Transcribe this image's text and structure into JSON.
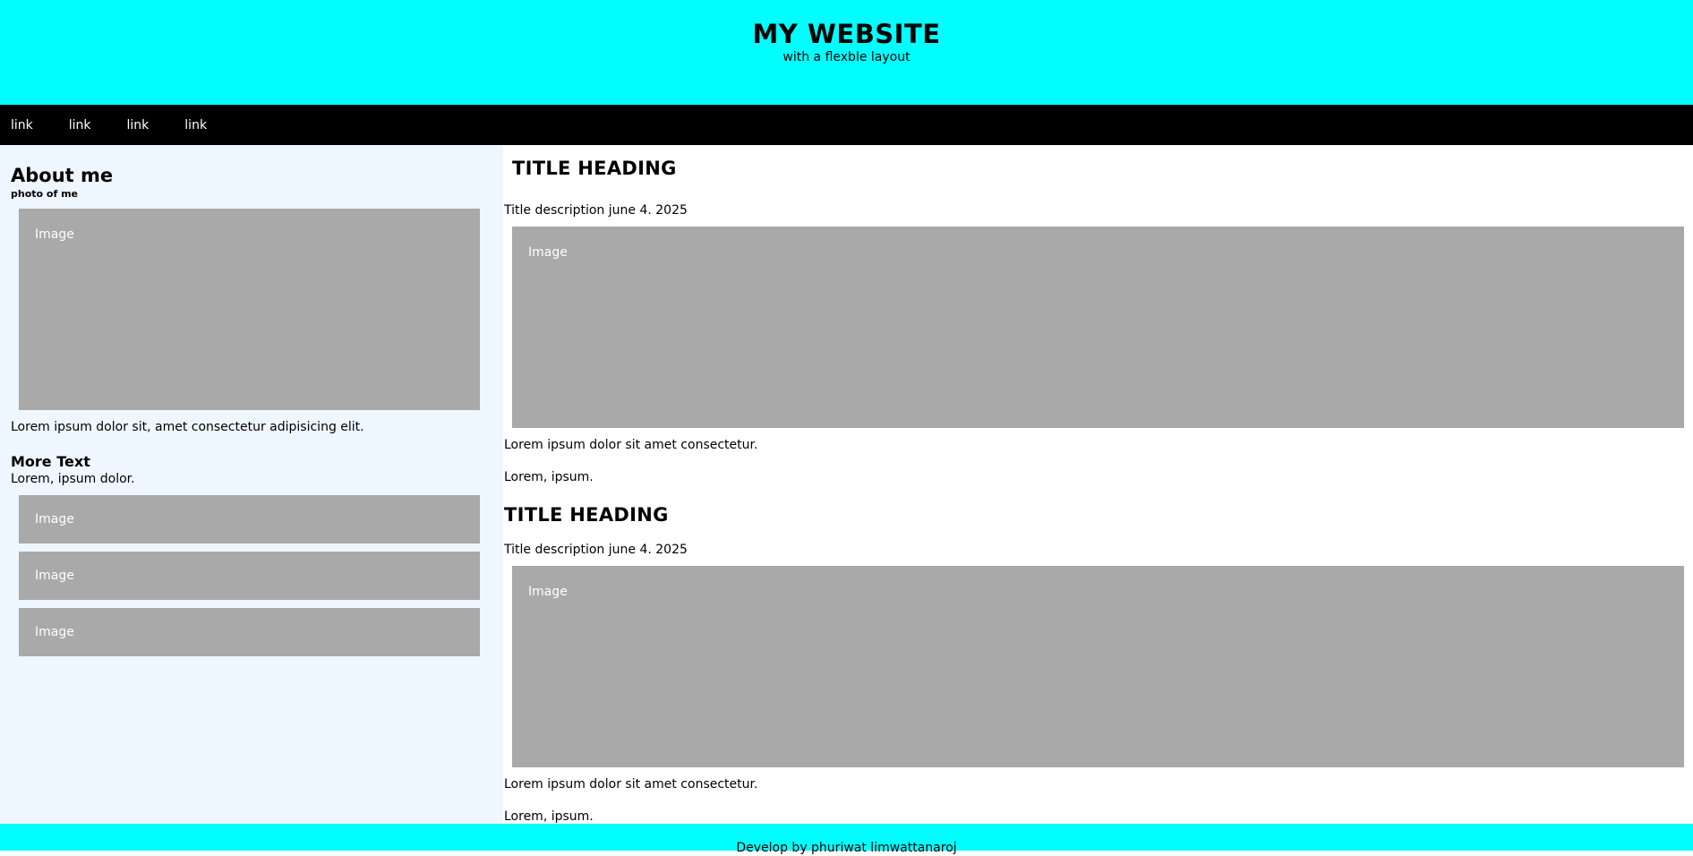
{
  "header": {
    "title": "MY WEBSITE",
    "subtitle": "with a flexble layout"
  },
  "nav": {
    "links": [
      "link",
      "link",
      "link",
      "link"
    ]
  },
  "sidebar": {
    "about_title": "About me",
    "photo_label": "photo of me",
    "main_image_label": "Image",
    "lorem": "Lorem ipsum dolor sit, amet consectetur adipisicing elit.",
    "more_title": "More Text",
    "more_text": "Lorem, ipsum dolor.",
    "thumb_images": [
      "Image",
      "Image",
      "Image"
    ]
  },
  "main": {
    "posts": [
      {
        "heading": "TITLE HEADING",
        "description": "Title description june 4. 2025",
        "image_label": "Image",
        "body": "Lorem ipsum dolor sit amet consectetur.",
        "body2": "Lorem, ipsum."
      },
      {
        "heading": "TITLE HEADING",
        "description": "Title description june 4. 2025",
        "image_label": "Image",
        "body": "Lorem ipsum dolor sit amet consectetur.",
        "body2": "Lorem, ipsum."
      }
    ]
  },
  "footer": {
    "text": "Develop by phuriwat limwattanaroj"
  },
  "colors": {
    "header_bg": "#00ffff",
    "nav_bg": "#000000",
    "sidebar_bg": "#eef7ff",
    "image_placeholder": "#a9a9a9"
  }
}
